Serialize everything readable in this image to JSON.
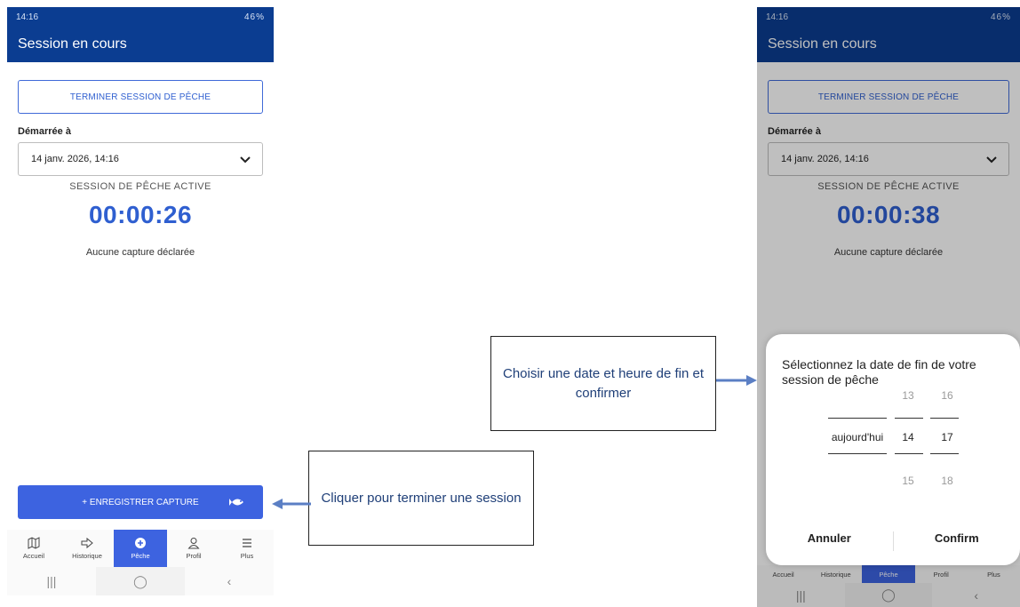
{
  "left_phone": {
    "status": {
      "time": "14:16",
      "right": "46%"
    },
    "appbar_title": "Session en cours",
    "end_button": "TERMINER SESSION DE PÊCHE",
    "started_label": "Démarrée à",
    "started_value": "14 janv. 2026, 14:16",
    "active_label": "SESSION DE PÊCHE ACTIVE",
    "timer": "00:00:26",
    "no_capture": "Aucune capture déclarée",
    "capture_button": "+ ENREGISTRER CAPTURE",
    "nav": [
      "Accueil",
      "Historique",
      "Pêche",
      "Profil",
      "Plus"
    ]
  },
  "right_phone": {
    "status": {
      "time": "14:16",
      "right": "46%"
    },
    "appbar_title": "Session en cours",
    "end_button": "TERMINER SESSION DE PÊCHE",
    "started_label": "Démarrée à",
    "started_value": "14 janv. 2026, 14:16",
    "active_label": "SESSION DE PÊCHE ACTIVE",
    "timer": "00:00:38",
    "no_capture": "Aucune capture déclarée",
    "nav": [
      "Accueil",
      "Historique",
      "Pêche",
      "Profil",
      "Plus"
    ],
    "dialog": {
      "title": "Sélectionnez la date de fin de votre session de pêche",
      "picker": {
        "day_selected": "aujourd'hui",
        "hour_above": "13",
        "hour_selected": "14",
        "hour_below": "15",
        "minute_above": "16",
        "minute_selected": "17",
        "minute_below": "18"
      },
      "cancel": "Annuler",
      "confirm": "Confirm"
    }
  },
  "callouts": {
    "end_session": "Cliquer pour terminer une session",
    "choose_date": "Choisir une date et heure de fin et confirmer"
  },
  "colors": {
    "primary": "#0b3d91",
    "accent": "#3d63e0",
    "callout_text": "#1f3f78"
  }
}
